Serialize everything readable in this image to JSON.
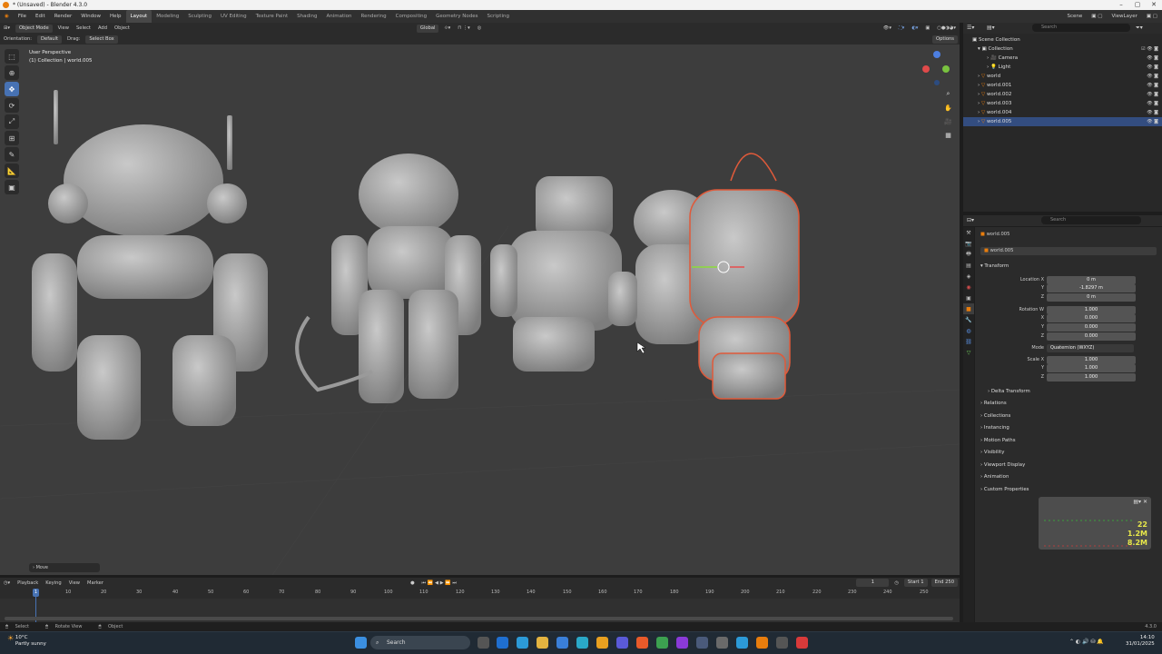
{
  "window": {
    "title": "* (Unsaved) - Blender 4.3.0",
    "controls": [
      "–",
      "▢",
      "✕"
    ]
  },
  "menu": [
    "File",
    "Edit",
    "Render",
    "Window",
    "Help"
  ],
  "workspaces": [
    "Layout",
    "Modeling",
    "Sculpting",
    "UV Editing",
    "Texture Paint",
    "Shading",
    "Animation",
    "Rendering",
    "Compositing",
    "Geometry Nodes",
    "Scripting"
  ],
  "active_workspace": "Layout",
  "topright": {
    "scene": "Scene",
    "view_layer": "ViewLayer"
  },
  "viewport_header": {
    "mode": "Object Mode",
    "menus": [
      "View",
      "Select",
      "Add",
      "Object"
    ],
    "transform": "Global",
    "options": "Options"
  },
  "tool_header": {
    "orientation_label": "Orientation:",
    "orientation": "Default",
    "drag_label": "Drag:",
    "drag": "Select Box"
  },
  "viewport": {
    "perspective": "User Perspective",
    "collection_info": "(1) Collection | world.005"
  },
  "operator_panel": "Move",
  "outliner": {
    "search_placeholder": "Search",
    "items": [
      {
        "name": "Scene Collection",
        "indent": 0
      },
      {
        "name": "Collection",
        "indent": 1
      },
      {
        "name": "Camera",
        "indent": 2
      },
      {
        "name": "Light",
        "indent": 2
      },
      {
        "name": "world",
        "indent": 1
      },
      {
        "name": "world.001",
        "indent": 1
      },
      {
        "name": "world.002",
        "indent": 1
      },
      {
        "name": "world.003",
        "indent": 1
      },
      {
        "name": "world.004",
        "indent": 1
      },
      {
        "name": "world.005",
        "indent": 1,
        "selected": true
      }
    ]
  },
  "properties": {
    "search_placeholder": "Search",
    "object_name": "world.005",
    "object_field": "world.005",
    "transform_label": "Transform",
    "location": {
      "label": "Location X",
      "x": "0 m",
      "y": "-1.8297 m",
      "z": "0 m"
    },
    "rotation": {
      "label": "Rotation W",
      "w": "1.000",
      "x": "0.000",
      "y": "0.000",
      "z": "0.000"
    },
    "mode_label": "Mode",
    "mode": "Quaternion (WXYZ)",
    "scale": {
      "label": "Scale X",
      "x": "1.000",
      "y": "1.000",
      "z": "1.000"
    },
    "axes": [
      "Y",
      "Z",
      "X"
    ],
    "panels": [
      "Delta Transform",
      "Relations",
      "Collections",
      "Instancing",
      "Motion Paths",
      "Visibility",
      "Viewport Display",
      "Animation",
      "Custom Properties"
    ]
  },
  "stats_overlay": {
    "fps": "22",
    "mem1": "1.2M",
    "mem2": "8.2M"
  },
  "timeline": {
    "menus": [
      "Playback",
      "Keying",
      "View",
      "Marker"
    ],
    "current_frame": "1",
    "start_label": "Start",
    "start": "1",
    "end_label": "End",
    "end": "250",
    "ticks": [
      "10",
      "20",
      "30",
      "40",
      "50",
      "60",
      "70",
      "80",
      "90",
      "100",
      "110",
      "120",
      "130",
      "140",
      "150",
      "160",
      "170",
      "180",
      "190",
      "200",
      "210",
      "220",
      "230",
      "240",
      "250"
    ]
  },
  "status_bar": [
    "Select",
    "Rotate View",
    "Object"
  ],
  "version": "4.3.0",
  "taskbar": {
    "weather_temp": "10°C",
    "weather_desc": "Partly sunny",
    "search": "Search",
    "time": "14:10",
    "date": "31/01/2025"
  },
  "colors": {
    "accent": "#4772b3",
    "selection_outline": "#e05a3a",
    "active_orange": "#e87d0d"
  }
}
